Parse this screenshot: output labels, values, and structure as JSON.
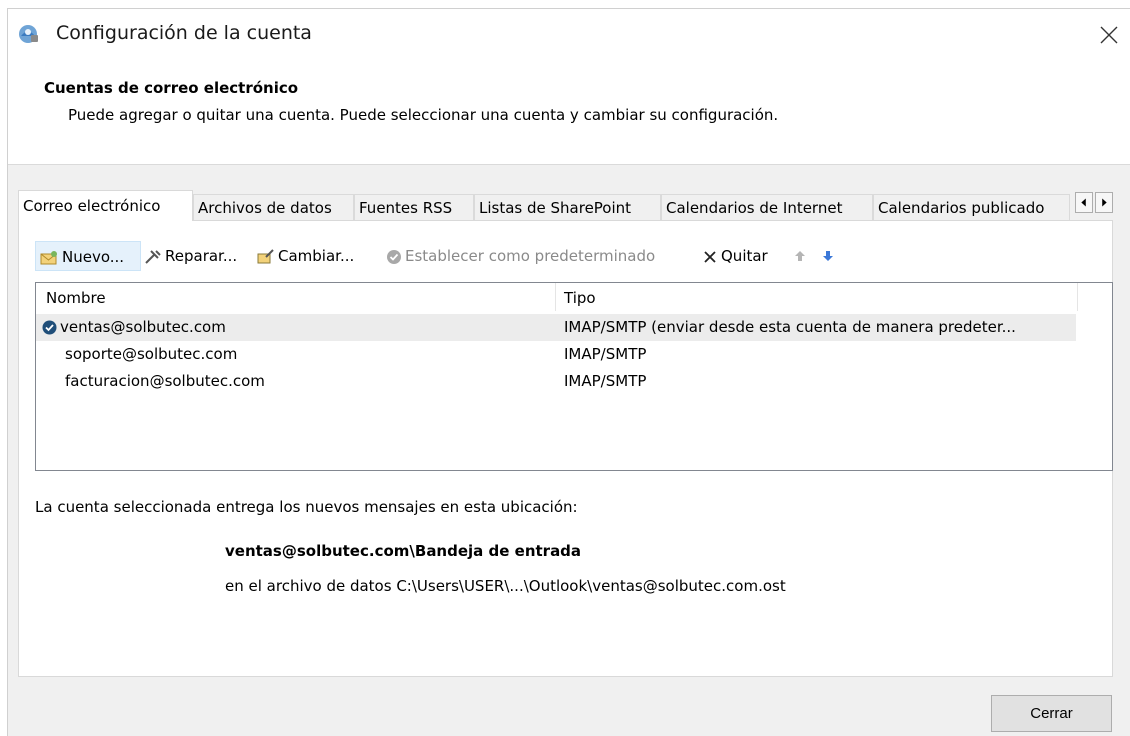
{
  "window": {
    "title": "Configuración de la cuenta",
    "icon": "account-settings-icon",
    "close_icon": "close-icon"
  },
  "header": {
    "title": "Cuentas de correo electrónico",
    "description": "Puede agregar o quitar una cuenta. Puede seleccionar una cuenta y cambiar su configuración."
  },
  "tabs": [
    {
      "label": "Correo electrónico",
      "active": true
    },
    {
      "label": "Archivos de datos",
      "active": false
    },
    {
      "label": "Fuentes RSS",
      "active": false
    },
    {
      "label": "Listas de SharePoint",
      "active": false
    },
    {
      "label": "Calendarios de Internet",
      "active": false
    },
    {
      "label": "Calendarios publicado",
      "active": false
    }
  ],
  "toolbar": {
    "new_label": "Nuevo...",
    "repair_label": "Reparar...",
    "change_label": "Cambiar...",
    "set_default_label": "Establecer como predeterminado",
    "remove_label": "Quitar"
  },
  "table": {
    "columns": [
      "Nombre",
      "Tipo"
    ],
    "rows": [
      {
        "name": "ventas@solbutec.com",
        "type": "IMAP/SMTP (enviar desde esta cuenta de manera predeter...",
        "default": true,
        "selected": true
      },
      {
        "name": "soporte@solbutec.com",
        "type": "IMAP/SMTP",
        "default": false,
        "selected": false
      },
      {
        "name": "facturacion@solbutec.com",
        "type": "IMAP/SMTP",
        "default": false,
        "selected": false
      }
    ]
  },
  "location": {
    "label": "La cuenta seleccionada entrega los nuevos mensajes en esta ubicación:",
    "path": "ventas@solbutec.com\\Bandeja de entrada",
    "file": "en el archivo de datos C:\\Users\\USER\\...\\Outlook\\ventas@solbutec.com.ost"
  },
  "footer": {
    "close_label": "Cerrar"
  },
  "colors": {
    "panel_bg": "#f0f0f0",
    "selected_row": "#ececec",
    "check_blue": "#1f4e79",
    "arrow_down_blue": "#3b78d8"
  }
}
